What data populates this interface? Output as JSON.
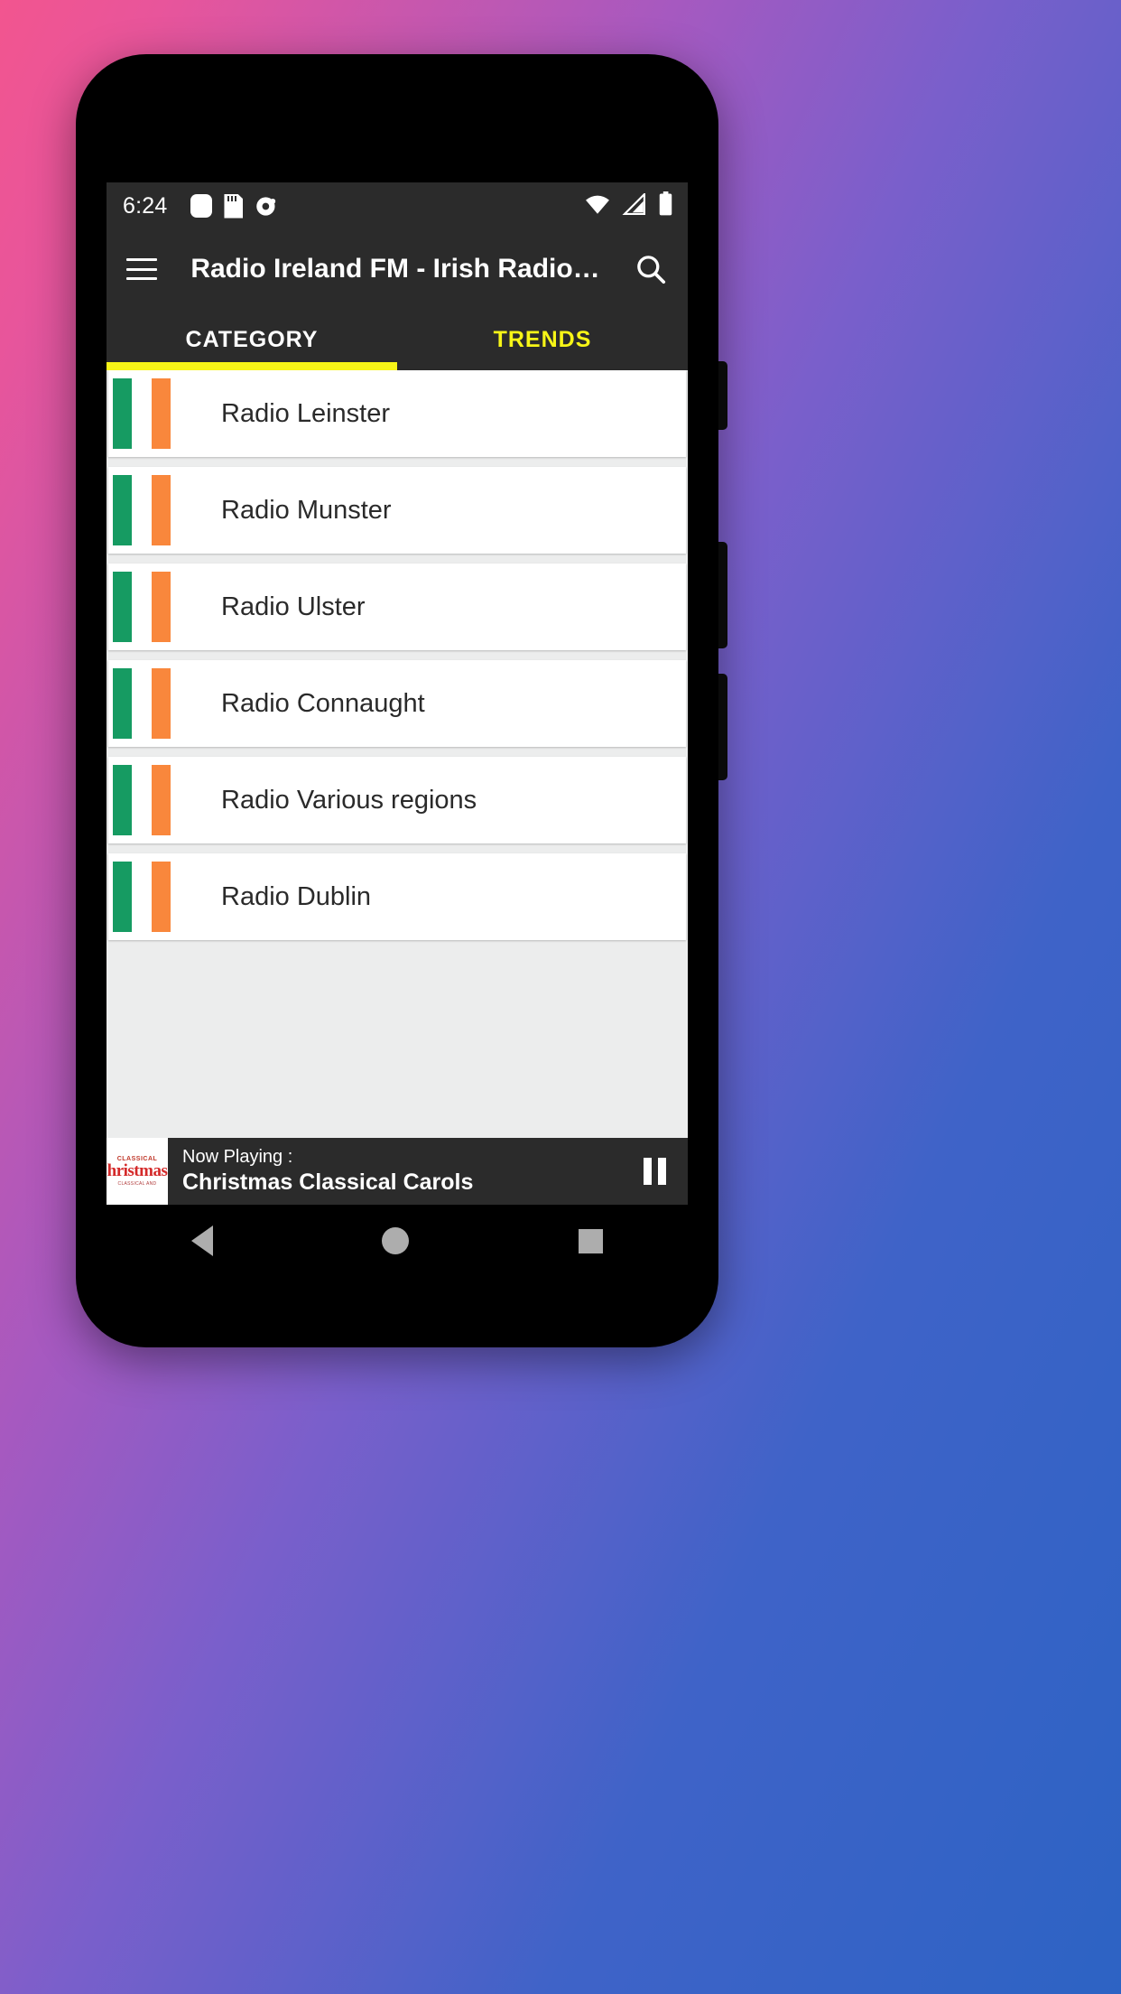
{
  "theme": {
    "accent_yellow": "#f7f517",
    "bar_dark": "#2b2b2b",
    "flag_green": "#169b62",
    "flag_orange": "#f9873c",
    "page_background": "#eceded"
  },
  "status_bar": {
    "time": "6:24",
    "left_icons": [
      "rounded-square-icon",
      "sdcard-icon",
      "headset-icon"
    ],
    "right_icons": [
      "wifi-icon",
      "cellular-signal-icon",
      "battery-icon"
    ]
  },
  "app_bar": {
    "menu_icon": "hamburger-menu-icon",
    "title": "Radio Ireland FM - Irish Radio…",
    "search_icon": "search-icon"
  },
  "tabs": [
    {
      "label": "CATEGORY",
      "active": true
    },
    {
      "label": "TRENDS",
      "active": false
    }
  ],
  "stations": [
    {
      "name": "Radio Leinster",
      "flag": "ireland-flag-icon"
    },
    {
      "name": "Radio Munster",
      "flag": "ireland-flag-icon"
    },
    {
      "name": "Radio Ulster",
      "flag": "ireland-flag-icon"
    },
    {
      "name": "Radio Connaught",
      "flag": "ireland-flag-icon"
    },
    {
      "name": "Radio Various regions",
      "flag": "ireland-flag-icon"
    },
    {
      "name": "Radio Dublin",
      "flag": "ireland-flag-icon"
    }
  ],
  "player": {
    "now_playing_label": "Now Playing :",
    "track_title": "Christmas Classical Carols",
    "pause_icon": "pause-icon",
    "album_art": {
      "top_text": "CLASSICAL",
      "main_text": "hristmas",
      "bottom_text": "CLASSICAL AND"
    }
  },
  "nav_bar": {
    "back": "back-triangle-icon",
    "home": "home-circle-icon",
    "recents": "recents-square-icon"
  }
}
